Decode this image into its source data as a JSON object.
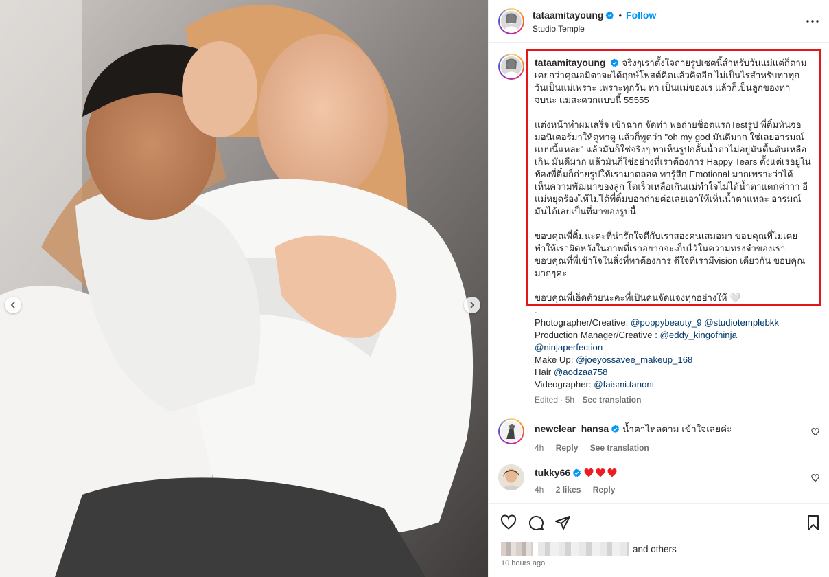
{
  "post": {
    "username": "tataamitayoung",
    "follow_label": "Follow",
    "separator": "•",
    "location": "Studio Temple"
  },
  "caption": {
    "username": "tataamitayoung",
    "para1": [
      "จริงๆเราตั้งใจถ่ายรูปเซตนี้สำหรับวันแม่แต่ก็ตาม",
      "เคยกว่าคุณอมิตาจะได้ฤกษ์โพสต์คิดแล้วคิดอีก ไม่เป็นไรสำหรับทาทุก",
      "วันเป็นแม่เพราะ เพราะทุกวัน ทา เป็นแม่ของเร แล้วก็เป็นลูกของทา",
      "จบนะ แม่สะดวกแบบนี้ 55555"
    ],
    "para2": [
      "แต่งหน้าทำผมเสร็จ เข้าฉาก จัดท่า พอถ่ายช็อตแรกTestรูป พี่ติ๋มหันจอ",
      "มอนิเตอร์มาให้ดูทาดู แล้วก็พูดว่า \"oh my god มันดีมาก ใช่เลยอารมณ์",
      "แบบนี้แหละ\" แล้วมันก็ใช่จริงๆ ทาเห็นรูปกลั้นน้ำตาไม่อยู่มันตื้นตันเหลือ",
      "เกิน มันดีมาก แล้วมันก็ใช่อย่างที่เราต้องการ Happy Tears ตั้งแต่เรอยู่ใน",
      "ท้องพี่ติ๋มก็ถ่ายรูปให้เรามาตลอด ทารู้สึก Emotional มากเพราะว่าได้",
      "เห็นความพัฒนาของลูก โตเร็วเหลือเกินแม่ทำใจไม่ได้น้ำตาแตกค่าาา อี",
      "แม่หยุดร้องไห้ไม่ได้พี่ติ๋มบอกถ่ายต่อเลยเอาให้เห็นน้ำตาแหละ อารมณ์",
      "มันได้เลยเป็นที่มาของรูปนี้"
    ],
    "para3": [
      "ขอบคุณพี่ติ๋มนะคะที่น่ารักใจดีกับเราสองคนเสมอมา ขอบคุณที่ไม่เคย",
      "ทำให้เราผิดหวังในภาพที่เราอยากจะเก็บไว้ในความทรงจำของเรา",
      "ขอบคุณที่พี่เข้าใจในสิ่งที่ทาต้องการ ดีใจที่เรามีvision เดียวกัน ขอบคุณ",
      "มากๆค่ะ"
    ],
    "para4": "ขอบคุณพี่เอ็ดด้วยนะคะที่เป็นคนจัดแจงทุกอย่างให้ 🤍",
    "dot": ".",
    "credits": {
      "photographer_label": "Photographer/Creative: ",
      "photographer_1": "@poppybeauty_9",
      "photographer_2": "@studiotemplebkk",
      "production_label": "Production Manager/Creative : ",
      "production_1": "@eddy_kingofninja",
      "production_2": "@ninjaperfection",
      "makeup_label": "Make Up: ",
      "makeup_1": "@joeyossavee_makeup_168",
      "hair_label": "Hair ",
      "hair_1": "@aodzaa758",
      "video_label": "Videographer: ",
      "video_1": "@faismi.tanont"
    },
    "edited": "Edited · 5h",
    "see_translation": "See translation"
  },
  "comments": [
    {
      "username": "newclear_hansa",
      "text": "น้ำตาไหลตาม เข้าใจเลยค่ะ",
      "time": "4h",
      "reply": "Reply",
      "see_translation": "See translation"
    },
    {
      "username": "tukky66",
      "text": "",
      "time": "4h",
      "likes": "2 likes",
      "reply": "Reply"
    }
  ],
  "footer": {
    "and_others": "and others",
    "time_ago": "10 hours ago"
  },
  "colors": {
    "accent": "#0095f6",
    "highlight_box": "#e2161b",
    "verified": "#0095f6",
    "heart": "#ed1c24"
  }
}
